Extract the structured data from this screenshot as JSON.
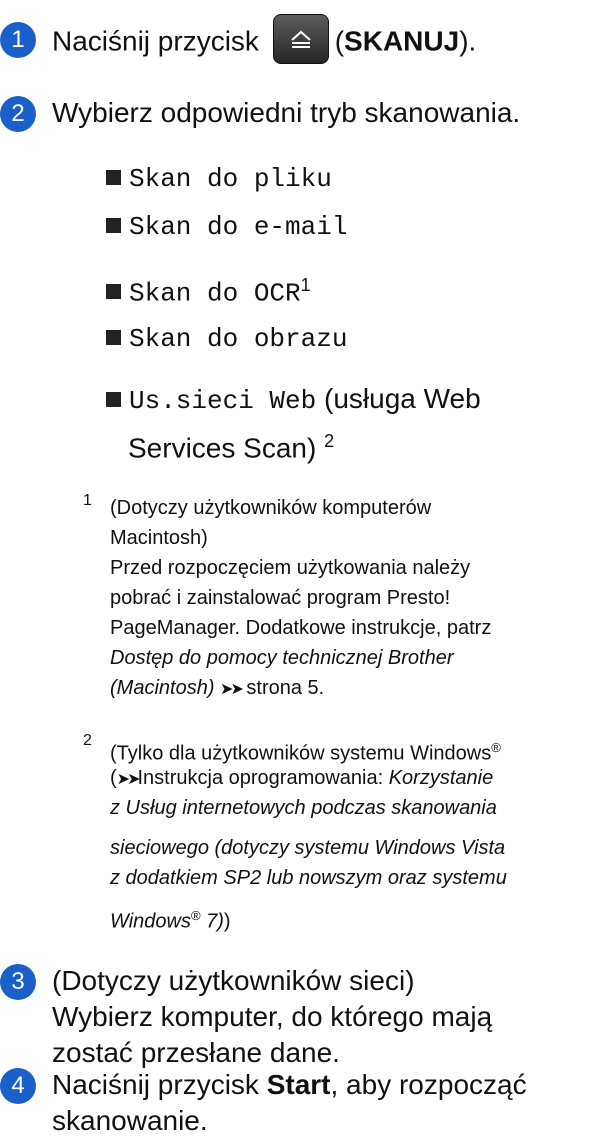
{
  "steps": [
    {
      "num": "1",
      "pre": "Naciśnij przycisk",
      "paren_open": "(",
      "bold": "SKANUJ",
      "paren_close": ")."
    },
    {
      "num": "2",
      "text": "Wybierz odpowiedni tryb skanowania."
    },
    {
      "num": "3",
      "line1": "(Dotyczy użytkowników sieci)",
      "line2": "Wybierz komputer, do którego mają",
      "line3": "zostać przesłane dane."
    },
    {
      "num": "4",
      "pre": "Naciśnij przycisk ",
      "bold": "Start",
      "post": ", aby rozpocząć",
      "line2": "skanowanie."
    }
  ],
  "options": [
    {
      "label": "Skan do pliku"
    },
    {
      "label": "Skan do e-mail"
    },
    {
      "label": "Skan do OCR",
      "sup": "1"
    },
    {
      "label": "Skan do obrazu"
    },
    {
      "label": "Us.sieci Web",
      "desc": " (usługa Web",
      "desc2": "Services Scan) ",
      "sup": "2"
    }
  ],
  "footnotes": {
    "f1": {
      "num": "1",
      "l1": "(Dotyczy użytkowników komputerów",
      "l2": "Macintosh)",
      "l3": "Przed rozpoczęciem użytkowania należy",
      "l4": "pobrać i zainstalować program Presto!",
      "l5": "PageManager. Dodatkowe instrukcje, patrz",
      "l6_i": "Dostęp do pomocy technicznej Brother",
      "l7_i": "(Macintosh)",
      "l7_arrow": "➤➤",
      "l7": " strona 5."
    },
    "f2": {
      "num": "2",
      "l1": "(Tylko dla użytkowników systemu Windows",
      "l1_sup": "®",
      "l2_open": "(",
      "l2_arrow": "➤➤",
      "l2": "Instrukcja oprogramowania: ",
      "l2_i": "Korzystanie",
      "l3_i": "z Usług internetowych podczas skanowania",
      "l4_i": "sieciowego (dotyczy systemu Windows Vista",
      "l5_i": "z dodatkiem SP2 lub nowszym oraz systemu",
      "l6_i": "Windows",
      "l6_sup": "®",
      "l6_i2": " 7)",
      "l6": ")"
    }
  }
}
